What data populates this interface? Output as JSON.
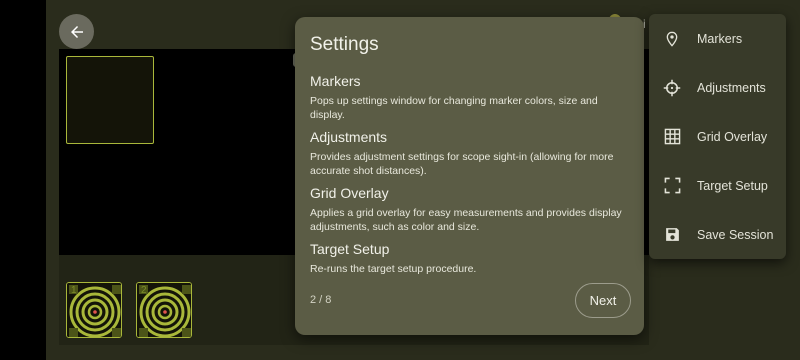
{
  "menu": {
    "items": [
      {
        "label": "Markers",
        "icon": "location-pin-icon"
      },
      {
        "label": "Adjustments",
        "icon": "crosshair-icon"
      },
      {
        "label": "Grid Overlay",
        "icon": "grid-icon"
      },
      {
        "label": "Target Setup",
        "icon": "viewfinder-icon"
      },
      {
        "label": "Save Session",
        "icon": "save-icon"
      }
    ]
  },
  "settings": {
    "title": "Settings",
    "sections": [
      {
        "title": "Markers",
        "description": "Pops up settings window for changing marker colors, size and display."
      },
      {
        "title": "Adjustments",
        "description": "Provides adjustment settings for scope sight-in (allowing for more accurate shot distances)."
      },
      {
        "title": "Grid Overlay",
        "description": "Applies a grid overlay for easy measurements and provides display adjustments, such as color and size."
      },
      {
        "title": "Target Setup",
        "description": "Re-runs the target setup procedure."
      }
    ],
    "page_indicator": "2 / 8",
    "next_label": "Next"
  },
  "thumbnails": [
    {
      "number": "1"
    },
    {
      "number": "2"
    }
  ],
  "colors": {
    "accent": "#a9b73a",
    "panel": "#5b5c45",
    "menu": "#383a29",
    "background": "#2a2c1c"
  }
}
